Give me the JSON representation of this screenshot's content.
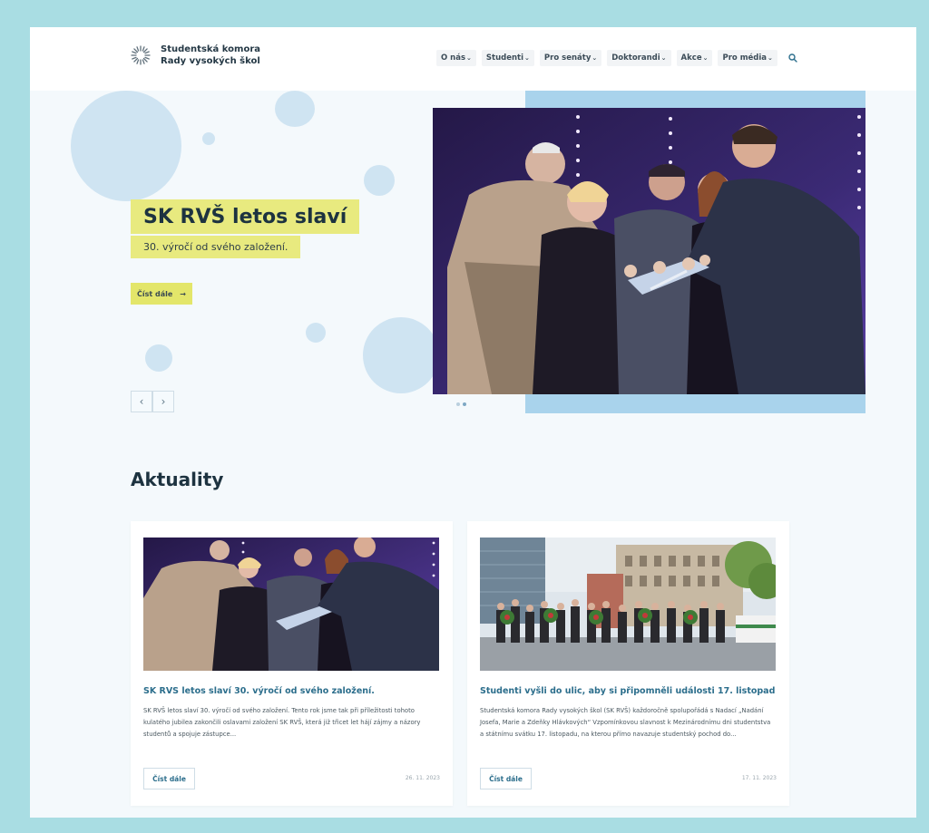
{
  "site": {
    "logo_line1": "Studentská komora",
    "logo_line2": "Rady vysokých škol",
    "logo_icon": "starburst-logo-icon"
  },
  "nav": {
    "items": [
      {
        "label": "O nás"
      },
      {
        "label": "Studenti"
      },
      {
        "label": "Pro senáty"
      },
      {
        "label": "Doktorandi"
      },
      {
        "label": "Akce"
      },
      {
        "label": "Pro média"
      }
    ],
    "chevron": "⌄",
    "search_icon": "search-icon"
  },
  "hero": {
    "title": "SK RVŠ letos slaví",
    "subtitle": "30. výročí od svého založení.",
    "cta_label": "Číst dále",
    "cta_arrow": "→",
    "prev_arrow": "‹",
    "next_arrow": "›",
    "slide_count": 2,
    "active_slide": 1,
    "photo": "ceremony-celebration-photo"
  },
  "news": {
    "section_title": "Aktuality",
    "cards": [
      {
        "title": "SK RVŠ letos slaví 30. výročí od svého založení.",
        "excerpt": "SK RVŠ letos slaví 30. výročí od svého založení. Tento rok jsme tak při příležitosti tohoto kulatého jubilea zakončili oslavami založení SK RVŠ, která již třicet let hájí zájmy a názory studentů a spojuje zástupce...",
        "button": "Číst dále",
        "date": "26. 11. 2023",
        "image": "ceremony-photo"
      },
      {
        "title": "Studenti vyšli do ulic, aby si připomněli události 17. listopadu",
        "excerpt": "Studentská komora Rady vysokých škol (SK RVŠ) každoročně spolupořádá s Nadací „Nadání Josefa, Marie a Zdeňky Hlávkových“ Vzpomínkovou slavnost k Mezinárodnímu dni studentstva a státnímu svátku 17. listopadu, na kterou přímo navazuje studentský pochod do...",
        "button": "Číst dále",
        "date": "17. 11. 2023",
        "image": "student-march-photo"
      }
    ]
  },
  "colors": {
    "outer_frame": "#a9dde3",
    "accent_yellow": "#e8ea7f",
    "accent_blue": "#a9d3ec",
    "link_blue": "#2c6e8c",
    "title_dark": "#1d3340"
  }
}
